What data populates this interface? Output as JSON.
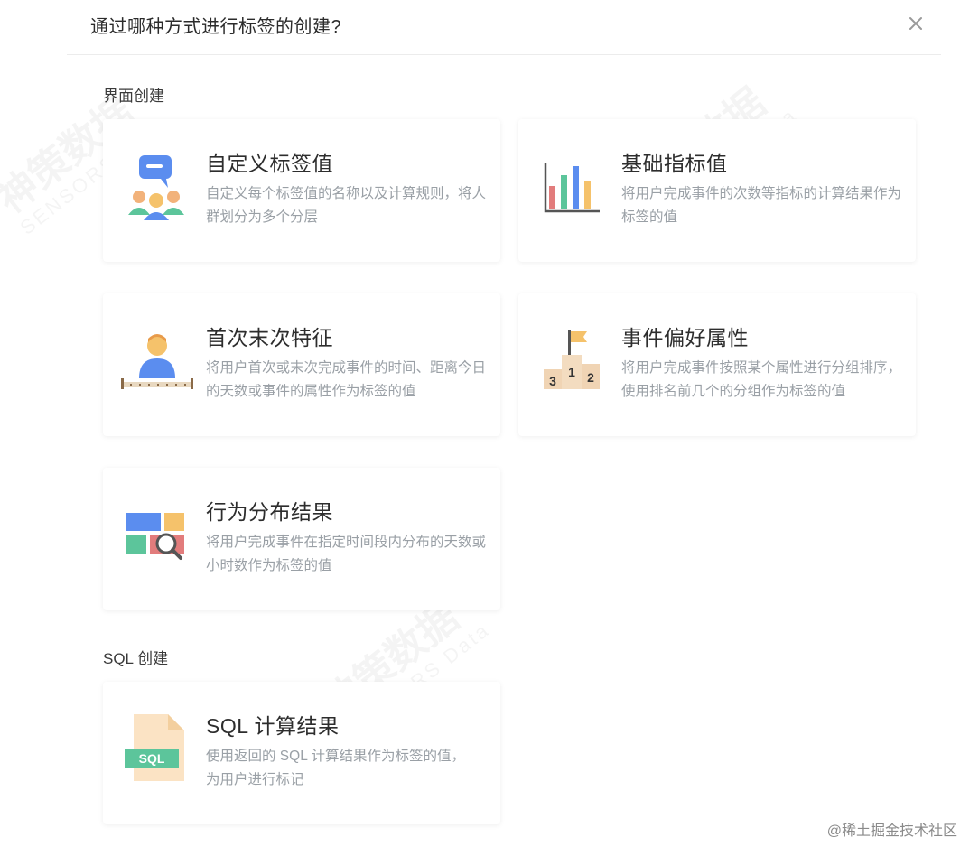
{
  "dialog": {
    "title": "通过哪种方式进行标签的创建?"
  },
  "sections": {
    "ui": "界面创建",
    "sql": "SQL 创建"
  },
  "cards": {
    "custom": {
      "title": "自定义标签值",
      "desc": "自定义每个标签值的名称以及计算规则，将人群划分为多个分层",
      "icon": "people-chat-icon"
    },
    "metric": {
      "title": "基础指标值",
      "desc": "将用户完成事件的次数等指标的计算结果作为标签的值",
      "icon": "bar-chart-icon"
    },
    "first_last": {
      "title": "首次末次特征",
      "desc": "将用户首次或末次完成事件的时间、距离今日的天数或事件的属性作为标签的值",
      "icon": "user-timeline-icon"
    },
    "preference": {
      "title": "事件偏好属性",
      "desc": "将用户完成事件按照某个属性进行分组排序，使用排名前几个的分组作为标签的值",
      "icon": "podium-icon"
    },
    "distribution": {
      "title": "行为分布结果",
      "desc": "将用户完成事件在指定时间段内分布的天数或小时数作为标签的值",
      "icon": "grid-search-icon"
    },
    "sql": {
      "title": "SQL 计算结果",
      "desc": "使用返回的 SQL 计算结果作为标签的值，为用户进行标记",
      "icon": "sql-file-icon",
      "icon_text": "SQL"
    }
  },
  "podium": {
    "first": "1",
    "second": "2",
    "third": "3"
  },
  "watermark": {
    "cn": "神策数据",
    "en": "SENSORS Data"
  },
  "corner_mark": "@稀土掘金技术社区",
  "colors": {
    "blue": "#5b8def",
    "green": "#5cc59b",
    "orange": "#f5c26b",
    "red": "#e27c7c"
  }
}
